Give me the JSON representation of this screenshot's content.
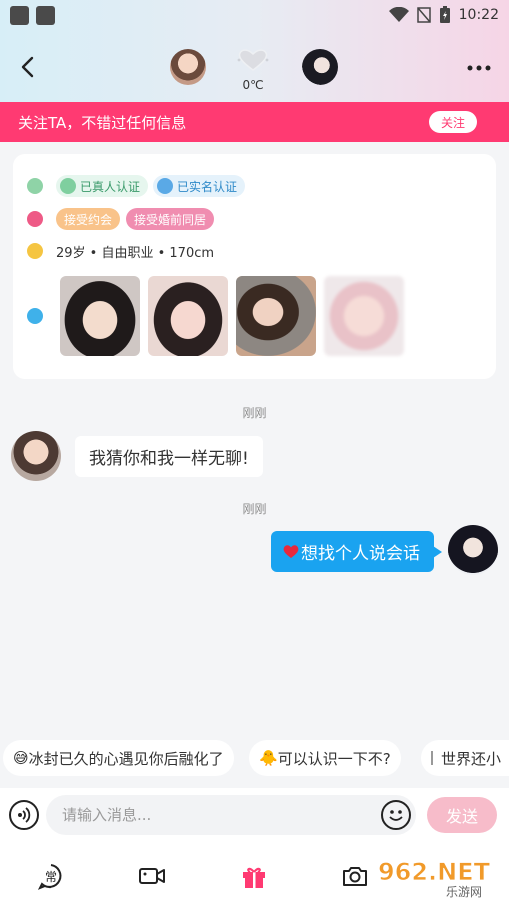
{
  "status_bar": {
    "time": "10:22"
  },
  "header": {
    "back_icon": "back-arrow-icon",
    "temperature": "0℃",
    "more_icon": "more-dots-icon"
  },
  "banner": {
    "text": "关注TA，不错过任何信息",
    "follow_label": "关注"
  },
  "profile_card": {
    "verify_tags": [
      "已真人认证",
      "已实名认证"
    ],
    "preference_tags": [
      "接受约会",
      "接受婚前同居"
    ],
    "info": "29岁 • 自由职业 • 170cm",
    "photos_count": 4,
    "colors": {
      "verify_green": "#3a9a6a",
      "verify_blue": "#2f8ac9",
      "tag_orange": "#f9c38a",
      "tag_pink": "#f08db0"
    }
  },
  "chat": {
    "messages": [
      {
        "time": "刚刚",
        "side": "left",
        "text": "我猜你和我一样无聊!"
      },
      {
        "time": "刚刚",
        "side": "right",
        "text": "想找个人说会话",
        "prefix_icon": "red-heart-icon"
      }
    ]
  },
  "quick_replies": [
    {
      "emoji": "😅",
      "text": "冰封已久的心遇见你后融化了"
    },
    {
      "emoji": "🐥",
      "text": "可以认识一下不?"
    },
    {
      "emoji": "",
      "text": "世界还小"
    }
  ],
  "input_bar": {
    "placeholder": "请输入消息...",
    "send_label": "发送"
  },
  "toolbar": {
    "items": [
      "常用语-icon",
      "video-call-icon",
      "gift-icon",
      "camera-icon"
    ],
    "common_label": "常"
  },
  "watermark": {
    "text": "962.NET",
    "subtext": "乐游网"
  },
  "colors": {
    "accent_pink": "#ff3a72",
    "bubble_blue": "#1aa3f0",
    "send_disabled": "#f7bcca"
  }
}
